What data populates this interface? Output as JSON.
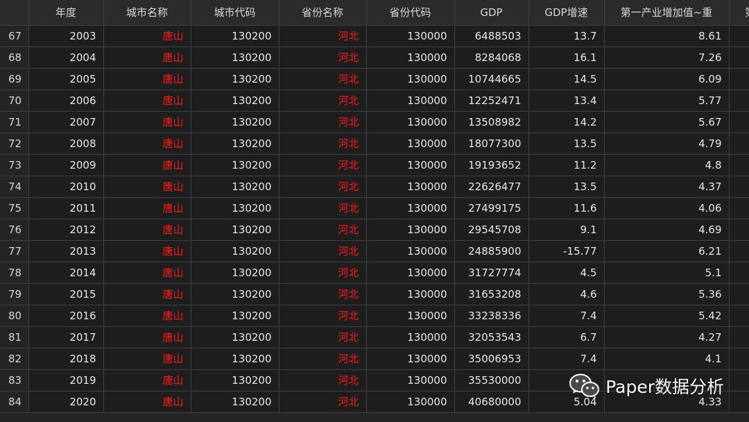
{
  "table": {
    "columns": [
      "",
      "年度",
      "城市名称",
      "城市代码",
      "省份名称",
      "省份代码",
      "GDP",
      "GDP增速",
      "第一产业增加值~重",
      "第"
    ],
    "rows": [
      {
        "idx": "67",
        "year": "2003",
        "city": "唐山",
        "city_code": "130200",
        "province": "河北",
        "province_code": "130000",
        "gdp": "6488503",
        "gdp_growth": "13.7",
        "primary": "8.61"
      },
      {
        "idx": "68",
        "year": "2004",
        "city": "唐山",
        "city_code": "130200",
        "province": "河北",
        "province_code": "130000",
        "gdp": "8284068",
        "gdp_growth": "16.1",
        "primary": "7.26"
      },
      {
        "idx": "69",
        "year": "2005",
        "city": "唐山",
        "city_code": "130200",
        "province": "河北",
        "province_code": "130000",
        "gdp": "10744665",
        "gdp_growth": "14.5",
        "primary": "6.09"
      },
      {
        "idx": "70",
        "year": "2006",
        "city": "唐山",
        "city_code": "130200",
        "province": "河北",
        "province_code": "130000",
        "gdp": "12252471",
        "gdp_growth": "13.4",
        "primary": "5.77"
      },
      {
        "idx": "71",
        "year": "2007",
        "city": "唐山",
        "city_code": "130200",
        "province": "河北",
        "province_code": "130000",
        "gdp": "13508982",
        "gdp_growth": "14.2",
        "primary": "5.67"
      },
      {
        "idx": "72",
        "year": "2008",
        "city": "唐山",
        "city_code": "130200",
        "province": "河北",
        "province_code": "130000",
        "gdp": "18077300",
        "gdp_growth": "13.5",
        "primary": "4.79"
      },
      {
        "idx": "73",
        "year": "2009",
        "city": "唐山",
        "city_code": "130200",
        "province": "河北",
        "province_code": "130000",
        "gdp": "19193652",
        "gdp_growth": "11.2",
        "primary": "4.8"
      },
      {
        "idx": "74",
        "year": "2010",
        "city": "唐山",
        "city_code": "130200",
        "province": "河北",
        "province_code": "130000",
        "gdp": "22626477",
        "gdp_growth": "13.5",
        "primary": "4.37"
      },
      {
        "idx": "75",
        "year": "2011",
        "city": "唐山",
        "city_code": "130200",
        "province": "河北",
        "province_code": "130000",
        "gdp": "27499175",
        "gdp_growth": "11.6",
        "primary": "4.06"
      },
      {
        "idx": "76",
        "year": "2012",
        "city": "唐山",
        "city_code": "130200",
        "province": "河北",
        "province_code": "130000",
        "gdp": "29545708",
        "gdp_growth": "9.1",
        "primary": "4.69"
      },
      {
        "idx": "77",
        "year": "2013",
        "city": "唐山",
        "city_code": "130200",
        "province": "河北",
        "province_code": "130000",
        "gdp": "24885900",
        "gdp_growth": "-15.77",
        "primary": "6.21"
      },
      {
        "idx": "78",
        "year": "2014",
        "city": "唐山",
        "city_code": "130200",
        "province": "河北",
        "province_code": "130000",
        "gdp": "31727774",
        "gdp_growth": "4.5",
        "primary": "5.1"
      },
      {
        "idx": "79",
        "year": "2015",
        "city": "唐山",
        "city_code": "130200",
        "province": "河北",
        "province_code": "130000",
        "gdp": "31653208",
        "gdp_growth": "4.6",
        "primary": "5.36"
      },
      {
        "idx": "80",
        "year": "2016",
        "city": "唐山",
        "city_code": "130200",
        "province": "河北",
        "province_code": "130000",
        "gdp": "33238336",
        "gdp_growth": "7.4",
        "primary": "5.42"
      },
      {
        "idx": "81",
        "year": "2017",
        "city": "唐山",
        "city_code": "130200",
        "province": "河北",
        "province_code": "130000",
        "gdp": "32053543",
        "gdp_growth": "6.7",
        "primary": "4.27"
      },
      {
        "idx": "82",
        "year": "2018",
        "city": "唐山",
        "city_code": "130200",
        "province": "河北",
        "province_code": "130000",
        "gdp": "35006953",
        "gdp_growth": "7.4",
        "primary": "4.1"
      },
      {
        "idx": "83",
        "year": "2019",
        "city": "唐山",
        "city_code": "130200",
        "province": "河北",
        "province_code": "130000",
        "gdp": "35530000",
        "gdp_growth": "",
        "primary": ""
      },
      {
        "idx": "84",
        "year": "2020",
        "city": "唐山",
        "city_code": "130200",
        "province": "河北",
        "province_code": "130000",
        "gdp": "40680000",
        "gdp_growth": "5.04",
        "primary": "4.33"
      }
    ]
  },
  "watermark": {
    "icon": "wechat-icon",
    "text": "Paper数据分析"
  },
  "colors": {
    "highlight_text": "#ff1a1a",
    "background": "#1e1e1e",
    "grid_line": "#3f3f46"
  }
}
